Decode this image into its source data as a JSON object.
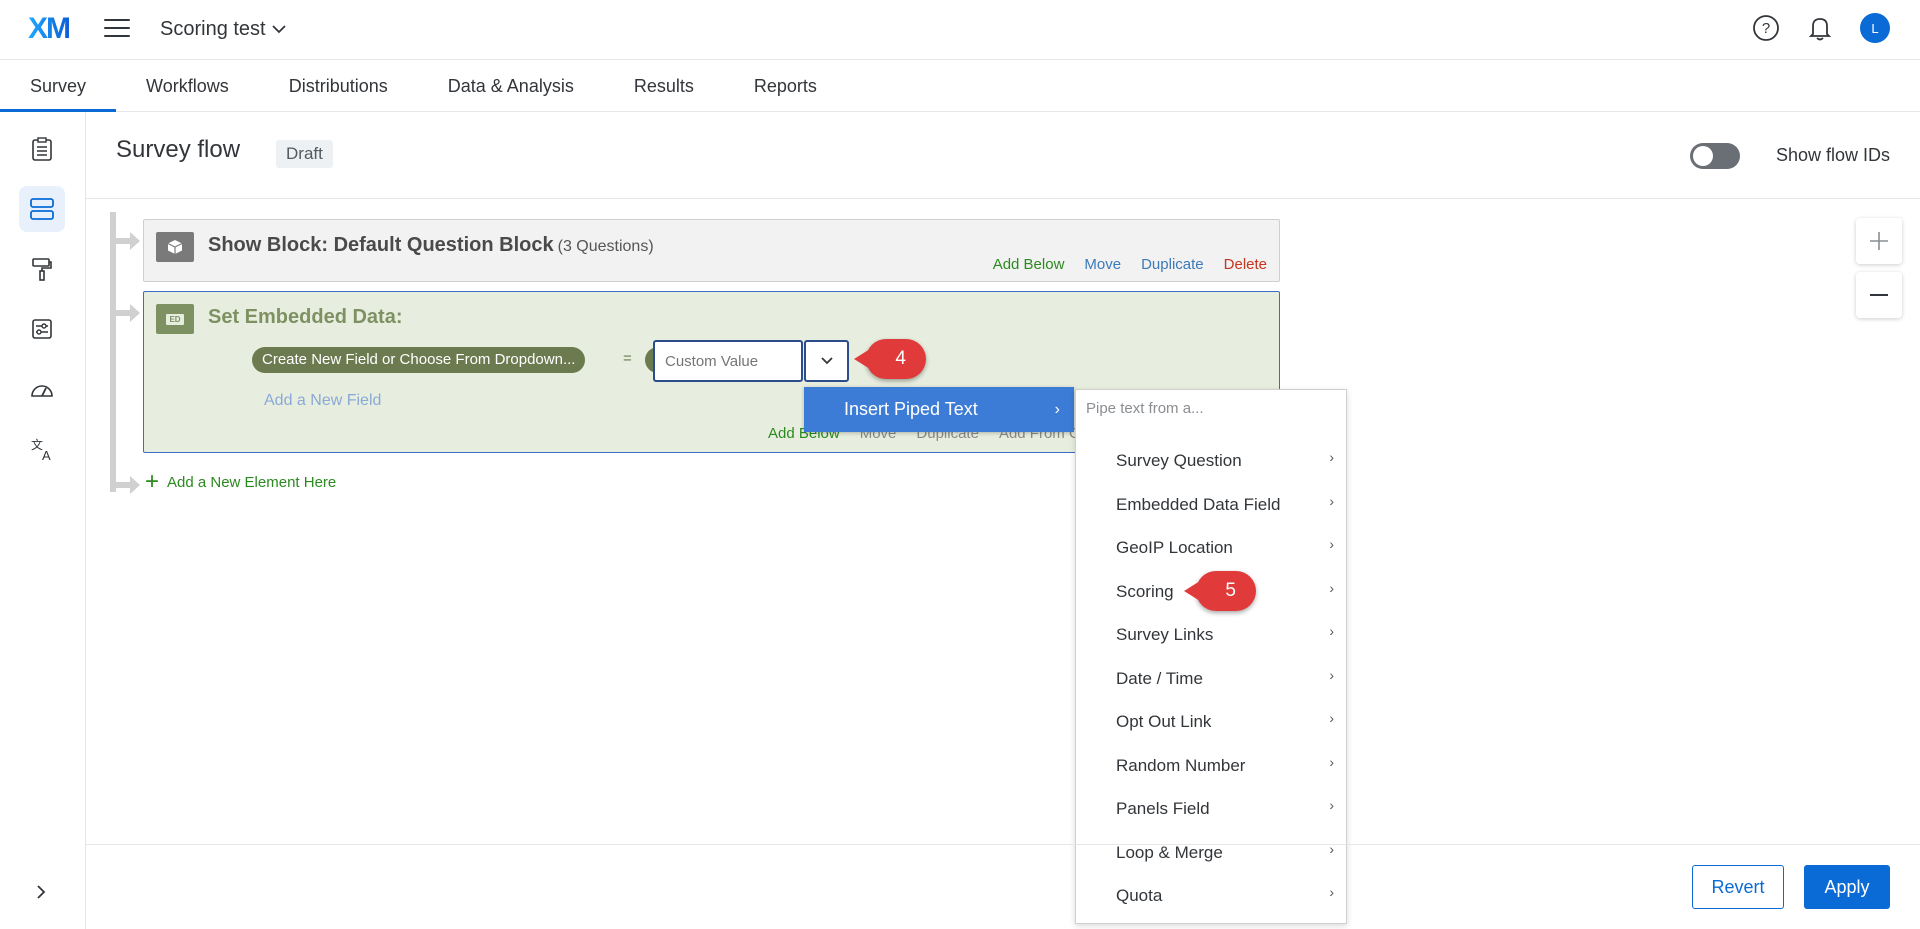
{
  "header": {
    "logo": "XM",
    "project_title": "Scoring test",
    "avatar_initial": "L"
  },
  "tabs": [
    {
      "label": "Survey"
    },
    {
      "label": "Workflows"
    },
    {
      "label": "Distributions"
    },
    {
      "label": "Data & Analysis"
    },
    {
      "label": "Results"
    },
    {
      "label": "Reports"
    }
  ],
  "page": {
    "title": "Survey flow",
    "badge": "Draft",
    "toggle_label": "Show flow IDs"
  },
  "show_block": {
    "title": "Show Block: Default Question Block",
    "subtitle": "(3 Questions)",
    "actions": {
      "add_below": "Add Below",
      "move": "Move",
      "duplicate": "Duplicate",
      "delete": "Delete"
    }
  },
  "embedded_block": {
    "title": "Set Embedded Data:",
    "icon_label": "ED",
    "field_pill": "Create New Field or Choose From Dropdown...",
    "equals": "=",
    "value_placeholder": "Custom Value",
    "add_field": "Add a New Field",
    "actions": {
      "add_below": "Add Below",
      "move": "Move",
      "duplicate": "Duplicate",
      "add_from": "Add From C"
    }
  },
  "add_element": "Add a New Element Here",
  "callouts": {
    "step4": "4",
    "step5": "5"
  },
  "piped_menu": {
    "label": "Insert Piped Text",
    "header": "Pipe text from a...",
    "items": [
      "Survey Question",
      "Embedded Data Field",
      "GeoIP Location",
      "Scoring",
      "Survey Links",
      "Date / Time",
      "Opt Out Link",
      "Random Number",
      "Panels Field",
      "Loop & Merge",
      "Quota"
    ]
  },
  "footer": {
    "revert": "Revert",
    "apply": "Apply"
  }
}
